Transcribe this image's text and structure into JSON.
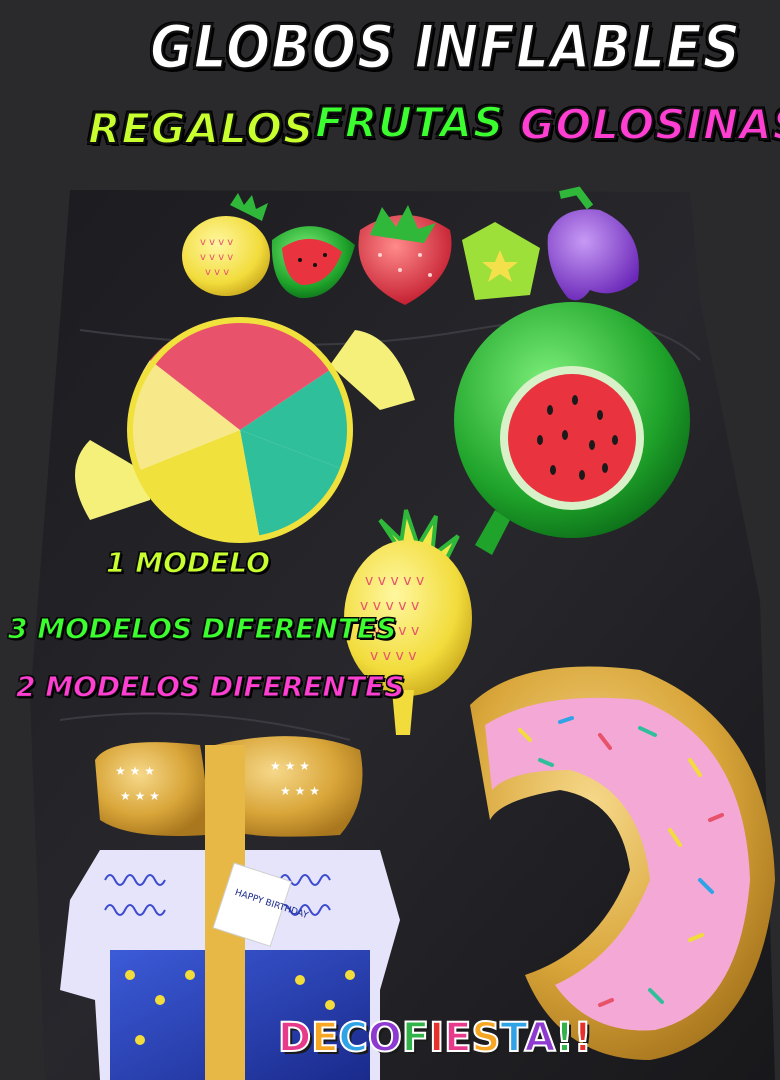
{
  "title": "GLOBOS INFLABLES",
  "categories": [
    {
      "label": "REGALOS",
      "color": "#c8ff2e"
    },
    {
      "label": "FRUTAS",
      "color": "#3bff2e"
    },
    {
      "label": "GOLOSINAS",
      "color": "#ff3ed2"
    }
  ],
  "tags": [
    {
      "label": "1 MODELO",
      "color": "#c8ff2e"
    },
    {
      "label": "3 MODELOS DIFERENTES",
      "color": "#3bff2e"
    },
    {
      "label": "2 MODELOS DIFERENTES",
      "color": "#ff3ed2"
    }
  ],
  "balloons": {
    "gift_card": "HAPPY BIRTHDAY"
  },
  "brand": "DECOFIESTA!!"
}
